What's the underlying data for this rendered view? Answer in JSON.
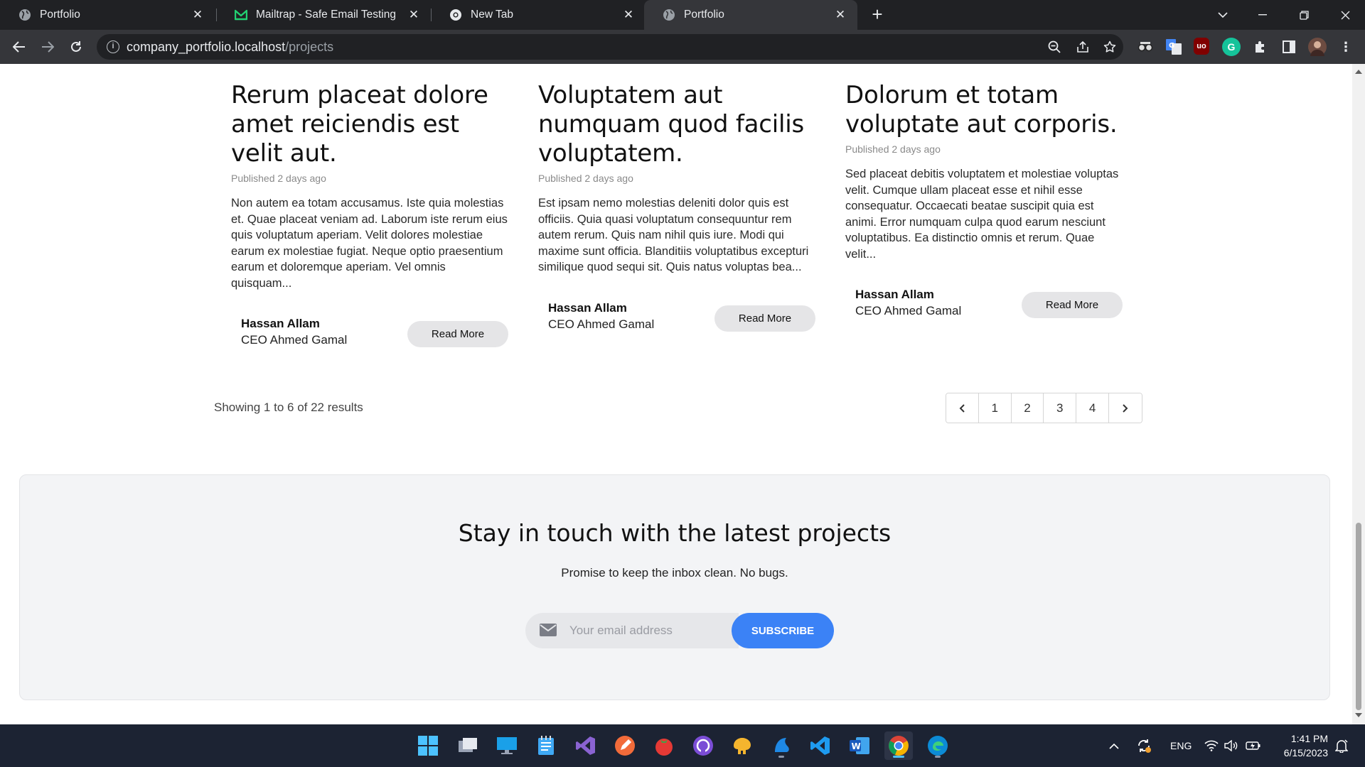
{
  "browser": {
    "tabs": [
      {
        "title": "Portfolio",
        "active": false
      },
      {
        "title": "Mailtrap - Safe Email Testing",
        "active": false
      },
      {
        "title": "New Tab",
        "active": false
      },
      {
        "title": "Portfolio",
        "active": true
      }
    ],
    "url_host": "company_portfolio.localhost",
    "url_path": "/projects"
  },
  "projects": [
    {
      "title": "Rerum placeat dolore amet reiciendis est velit aut.",
      "published": "Published 2 days ago",
      "excerpt": "Non autem ea totam accusamus. Iste quia molestias et. Quae placeat veniam ad. Laborum iste rerum eius quis voluptatum aperiam. Velit dolores molestiae earum ex molestiae fugiat. Neque optio praesentium earum et doloremque aperiam. Vel omnis quisquam...",
      "author_name": "Hassan Allam",
      "author_role": "CEO Ahmed Gamal",
      "read_more": "Read More"
    },
    {
      "title": "Voluptatem aut numquam quod facilis voluptatem.",
      "published": "Published 2 days ago",
      "excerpt": "Est ipsam nemo molestias deleniti dolor quis est officiis. Quia quasi voluptatum consequuntur rem autem rerum. Quis nam nihil quis iure. Modi qui maxime sunt officia. Blanditiis voluptatibus excepturi similique quod sequi sit. Quis natus voluptas bea...",
      "author_name": "Hassan Allam",
      "author_role": "CEO Ahmed Gamal",
      "read_more": "Read More"
    },
    {
      "title": "Dolorum et totam voluptate aut corporis.",
      "published": "Published 2 days ago",
      "excerpt": "Sed placeat debitis voluptatem et molestiae voluptas velit. Cumque ullam placeat esse et nihil esse consequatur. Occaecati beatae suscipit quia est animi. Error numquam culpa quod earum nesciunt voluptatibus. Ea distinctio omnis et rerum. Quae velit...",
      "author_name": "Hassan Allam",
      "author_role": "CEO Ahmed Gamal",
      "read_more": "Read More"
    }
  ],
  "pagination": {
    "summary": "Showing 1 to 6 of 22 results",
    "pages": [
      "1",
      "2",
      "3",
      "4"
    ]
  },
  "newsletter": {
    "heading": "Stay in touch with the latest projects",
    "subheading": "Promise to keep the inbox clean. No bugs.",
    "email_placeholder": "Your email address",
    "button": "SUBSCRIBE"
  },
  "taskbar": {
    "language": "ENG",
    "time": "1:41 PM",
    "date": "6/15/2023"
  },
  "colors": {
    "accent": "#3b82f6",
    "newsletter_bg": "#f3f4f6",
    "chrome_dark": "#202124",
    "chrome_toolbar": "#35363a",
    "taskbar": "#1c2333"
  }
}
